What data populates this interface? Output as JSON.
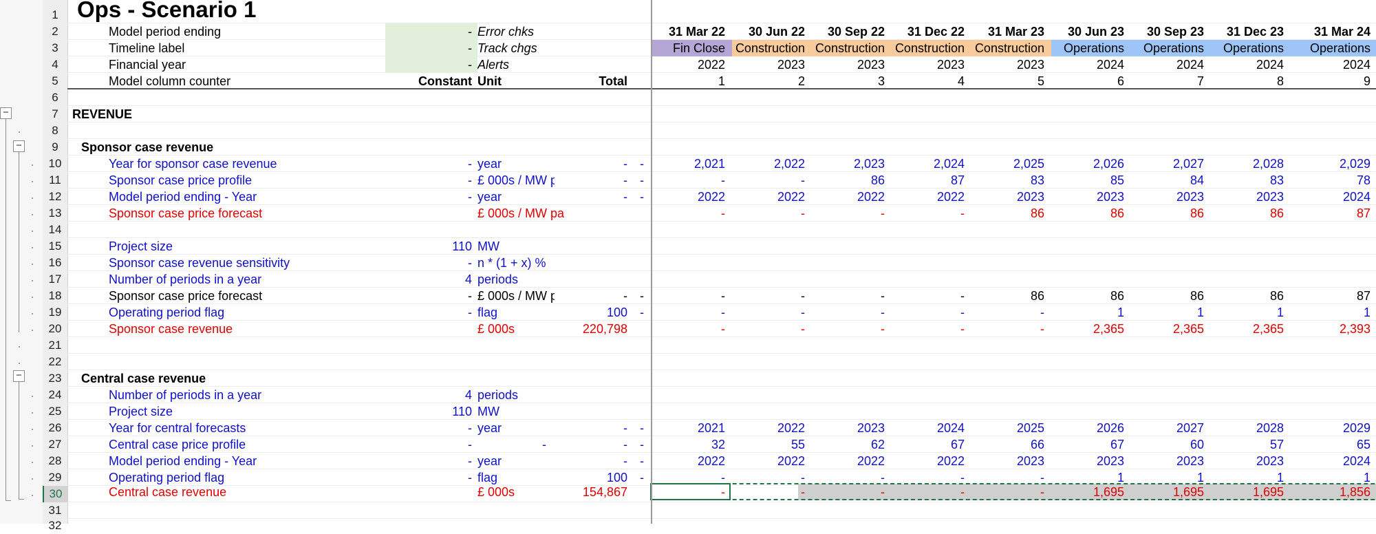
{
  "sheet": {
    "title": "Ops - Scenario 1",
    "row_numbers": [
      "1",
      "2",
      "3",
      "4",
      "5",
      "6",
      "7",
      "8",
      "9",
      "10",
      "11",
      "12",
      "13",
      "14",
      "15",
      "16",
      "17",
      "18",
      "19",
      "20",
      "21",
      "22",
      "23",
      "24",
      "25",
      "26",
      "27",
      "28",
      "29",
      "30",
      "31",
      "32"
    ]
  },
  "header": {
    "labels": {
      "r2": "Model period ending",
      "r3": "Timeline label",
      "r4": "Financial year",
      "r5": "Model column counter"
    },
    "green_vals": {
      "r2": "-",
      "r3": "-",
      "r4": "-"
    },
    "checks": {
      "r2": "Error chks",
      "r3": "Track chgs",
      "r4": "Alerts"
    },
    "r5_constant": "Constant",
    "r5_unit": "Unit",
    "r5_total": "Total",
    "dates": [
      "31 Mar 22",
      "30 Jun 22",
      "30 Sep 22",
      "31 Dec 22",
      "31 Mar 23",
      "30 Jun 23",
      "30 Sep 23",
      "31 Dec 23",
      "31 Mar 24"
    ],
    "phases": [
      "Fin Close",
      "Construction",
      "Construction",
      "Construction",
      "Construction",
      "Operations",
      "Operations",
      "Operations",
      "Operations"
    ],
    "fin_years": [
      "2022",
      "2023",
      "2023",
      "2023",
      "2023",
      "2024",
      "2024",
      "2024",
      "2024"
    ],
    "counters": [
      "1",
      "2",
      "3",
      "4",
      "5",
      "6",
      "7",
      "8",
      "9"
    ]
  },
  "phase_colors": {
    "fin": "#b4a7d6",
    "con": "#f9cb9c",
    "ops": "#9fc5f8"
  },
  "revenue": {
    "heading": "REVENUE"
  },
  "sponsor": {
    "heading": "Sponsor case revenue",
    "r10": {
      "label": "Year for sponsor case revenue",
      "const": "-",
      "unit": "year",
      "total": "-",
      "flag": "-",
      "vals": [
        "2,021",
        "2,022",
        "2,023",
        "2,024",
        "2,025",
        "2,026",
        "2,027",
        "2,028",
        "2,029"
      ]
    },
    "r11": {
      "label": "Sponsor case price profile",
      "const": "-",
      "unit": "£ 000s / MW p",
      "total": "-",
      "flag": "-",
      "vals": [
        "-",
        "-",
        "86",
        "87",
        "83",
        "85",
        "84",
        "83",
        "78"
      ]
    },
    "r12": {
      "label": "Model period ending - Year",
      "const": "-",
      "unit": "year",
      "total": "-",
      "flag": "-",
      "vals": [
        "2022",
        "2022",
        "2022",
        "2022",
        "2023",
        "2023",
        "2023",
        "2023",
        "2024"
      ]
    },
    "r13": {
      "label": "Sponsor case price forecast",
      "unit": "£ 000s / MW pa",
      "vals": [
        "-",
        "-",
        "-",
        "-",
        "86",
        "86",
        "86",
        "86",
        "87"
      ]
    },
    "r15": {
      "label": "Project size",
      "const": "110",
      "unit": "MW"
    },
    "r16": {
      "label": "Sponsor case revenue sensitivity",
      "const": "-",
      "unit": "n * (1 + x) %"
    },
    "r17": {
      "label": "Number of periods in a year",
      "const": "4",
      "unit": "periods"
    },
    "r18": {
      "label": "Sponsor case price forecast",
      "const": "-",
      "unit": "£ 000s / MW p",
      "total": "-",
      "flag": "-",
      "vals": [
        "-",
        "-",
        "-",
        "-",
        "86",
        "86",
        "86",
        "86",
        "87"
      ]
    },
    "r19": {
      "label": "Operating period flag",
      "const": "-",
      "unit": "flag",
      "total": "100",
      "flag": "-",
      "vals": [
        "-",
        "-",
        "-",
        "-",
        "-",
        "1",
        "1",
        "1",
        "1"
      ]
    },
    "r20": {
      "label": "Sponsor case revenue",
      "unit": "£ 000s",
      "total": "220,798",
      "vals": [
        "-",
        "-",
        "-",
        "-",
        "-",
        "2,365",
        "2,365",
        "2,365",
        "2,393"
      ]
    }
  },
  "central": {
    "heading": "Central case revenue",
    "r24": {
      "label": "Number of periods in a year",
      "const": "4",
      "unit": "periods"
    },
    "r25": {
      "label": "Project size",
      "const": "110",
      "unit": "MW"
    },
    "r26": {
      "label": "Year for central forecasts",
      "const": "-",
      "unit": "year",
      "total": "-",
      "flag": "-",
      "vals": [
        "2021",
        "2022",
        "2023",
        "2024",
        "2025",
        "2026",
        "2027",
        "2028",
        "2029"
      ]
    },
    "r27": {
      "label": "Central case price profile",
      "const": "-",
      "unit_dash": "-",
      "total": "-",
      "flag": "-",
      "vals": [
        "32",
        "55",
        "62",
        "67",
        "66",
        "67",
        "60",
        "57",
        "65"
      ]
    },
    "r28": {
      "label": "Model period ending - Year",
      "const": "-",
      "unit": "year",
      "total": "-",
      "flag": "-",
      "vals": [
        "2022",
        "2022",
        "2022",
        "2022",
        "2023",
        "2023",
        "2023",
        "2023",
        "2024"
      ]
    },
    "r29": {
      "label": "Operating period flag",
      "const": "-",
      "unit": "flag",
      "total": "100",
      "flag": "-",
      "vals": [
        "-",
        "-",
        "-",
        "-",
        "-",
        "1",
        "1",
        "1",
        "1"
      ]
    },
    "r30": {
      "label": "Central case revenue",
      "unit": "£ 000s",
      "total": "154,867",
      "vals": [
        "-",
        "-",
        "-",
        "-",
        "-",
        "1,695",
        "1,695",
        "1,695",
        "1,856"
      ]
    }
  },
  "outline": {
    "collapse_symbol": "−"
  }
}
